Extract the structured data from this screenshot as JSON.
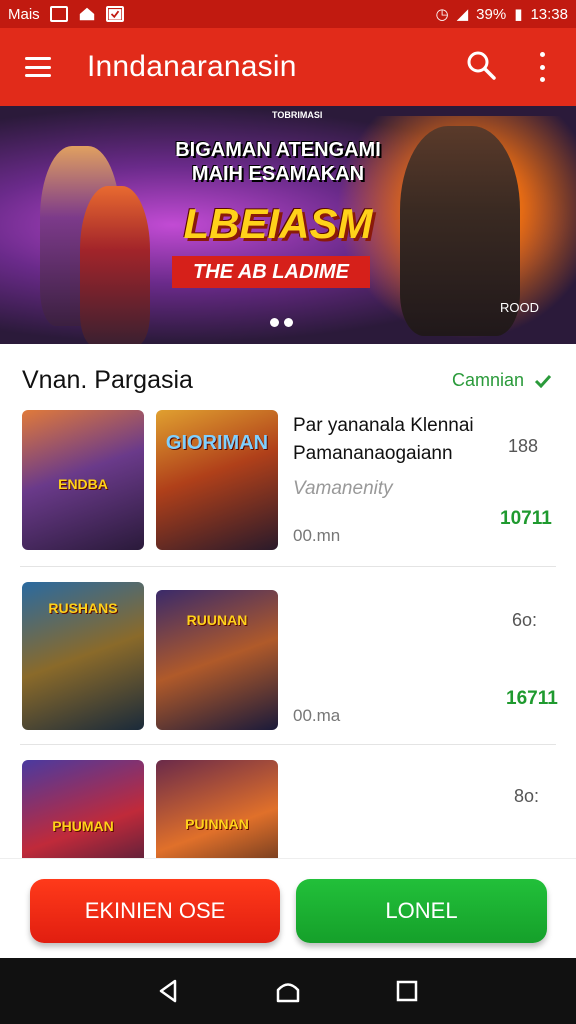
{
  "status_bar": {
    "left_text": "Mais",
    "battery": "39%",
    "time": "13:38"
  },
  "app_bar": {
    "title": "Inndanaranasin"
  },
  "banner": {
    "title_line1": "BIGAMAN ATENGAMI",
    "title_line2": "MAIH ESAMAKAN",
    "headline": "LBEIASM",
    "tagline": "THE AB LADIME",
    "small_text": "TOBRIMASI",
    "corner_text": "ROOD",
    "current_slide": 1,
    "total_slides": 2
  },
  "section": {
    "title": "Vnan. Pargasia",
    "link_label": "Camnian"
  },
  "rows": [
    {
      "thumb1_label": "ENDBA",
      "thumb2_label": "GIORIMAN",
      "title_line1": "Par yananala Klennai",
      "title_line2": "Pamananaogaiann",
      "subtitle": "Vamanenity",
      "time": "00.mn",
      "count": "188",
      "price": "10711"
    },
    {
      "thumb1_label": "RUSHANS",
      "thumb2_label": "RUUNAN",
      "time": "00.ma",
      "count": "6o:",
      "price": "16711"
    },
    {
      "thumb1_label": "PHUMAN",
      "thumb2_label": "PUINNAN",
      "count": "8o:"
    }
  ],
  "buttons": {
    "primary": "EKINIEN OSE",
    "secondary": "LONEL"
  },
  "colors": {
    "primary_red": "#e12b1a",
    "accent_green": "#1f9a2f"
  }
}
